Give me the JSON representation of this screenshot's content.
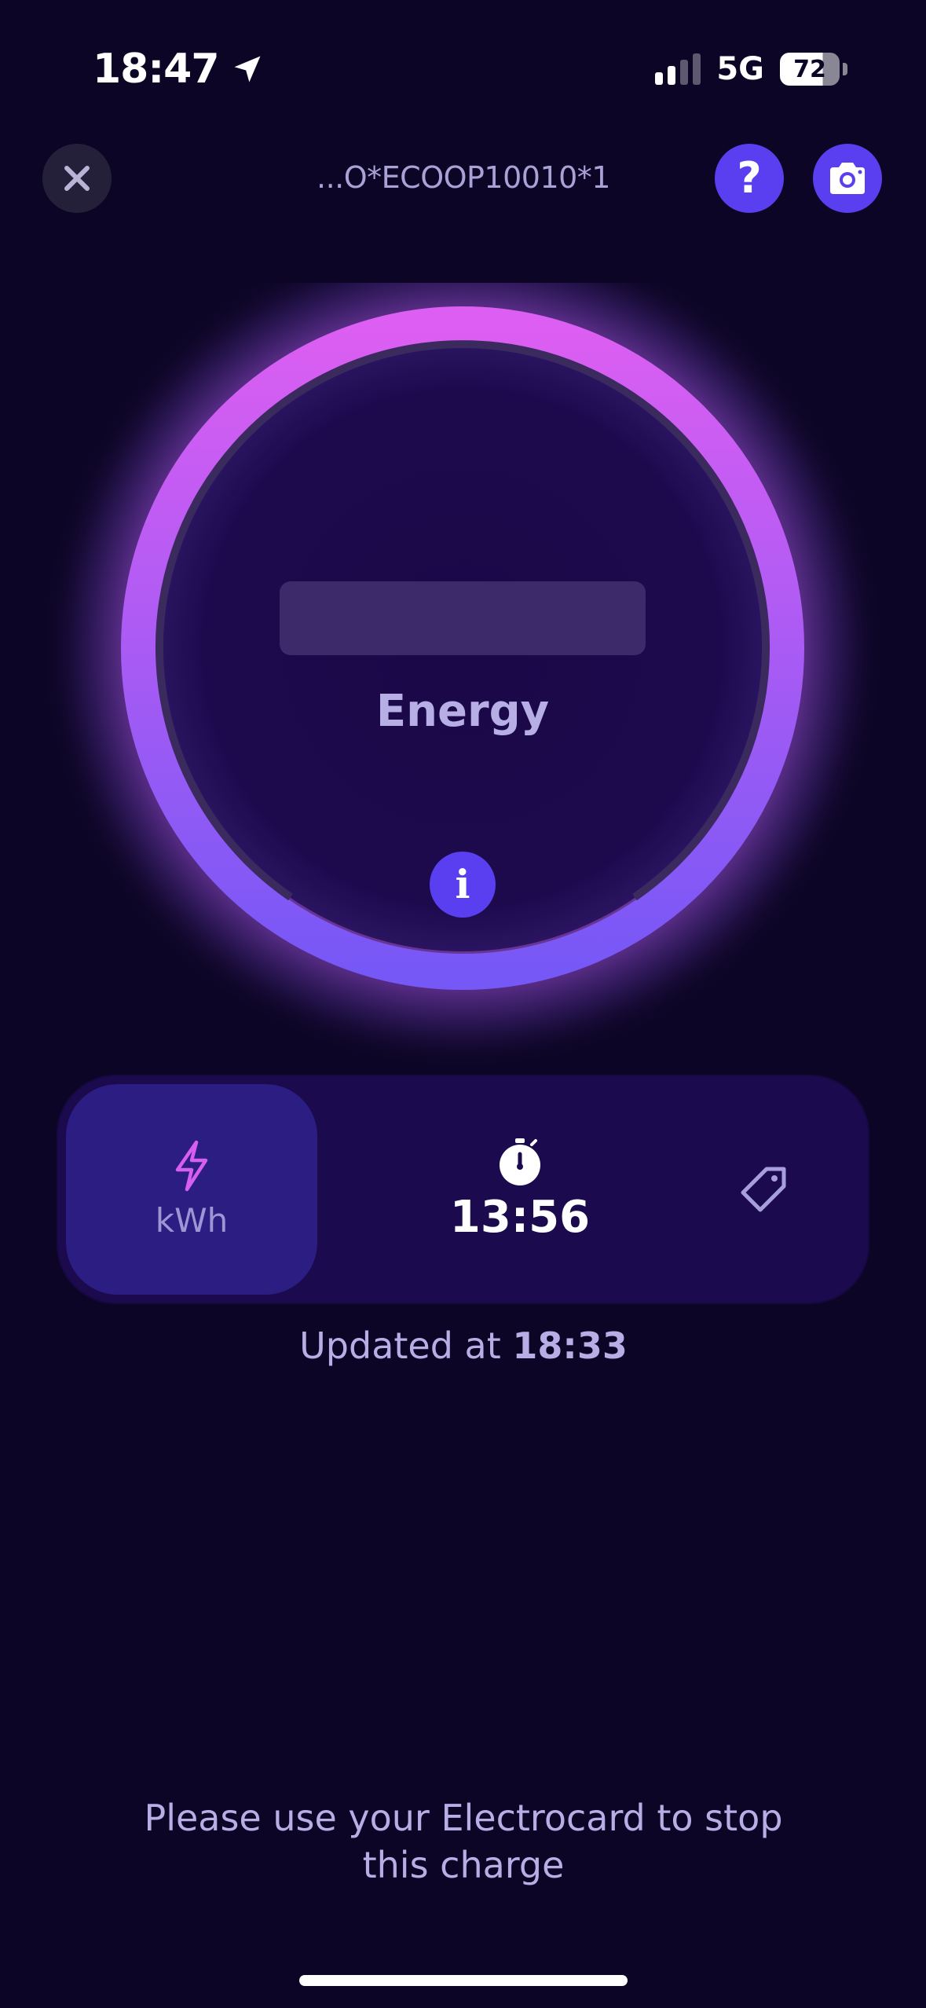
{
  "status_bar": {
    "time": "18:47",
    "network": "5G",
    "battery_level": "72",
    "signal_bars_active": 2,
    "signal_bars_total": 4
  },
  "header": {
    "station_id": "...O*ECOOP10010*1",
    "help_label": "?"
  },
  "gauge": {
    "label": "Energy",
    "info_label": "i",
    "colors": {
      "ring_top": "#d95ef2",
      "ring_bottom": "#7a5cf6",
      "inner": "#1b0a4a"
    }
  },
  "metrics": {
    "energy_unit": "kWh",
    "duration": "13:56"
  },
  "updated": {
    "prefix": "Updated at ",
    "time": "18:33"
  },
  "footer": {
    "message_line1": "Please use your Electrocard to stop",
    "message_line2": "this charge"
  },
  "icons": {
    "close": "close-icon",
    "help": "question-icon",
    "camera": "camera-icon",
    "info": "info-icon",
    "energy": "lightning-icon",
    "timer": "stopwatch-icon",
    "price": "tag-icon",
    "location": "location-arrow-icon"
  },
  "theme": {
    "background": "#0c0525",
    "accent": "#5a3ff0",
    "text_muted": "#b7aee6"
  }
}
